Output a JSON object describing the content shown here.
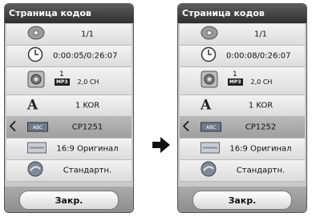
{
  "left": {
    "title": "Страница кодов",
    "title_page": "1/1",
    "time": "0:00:05/0:26:07",
    "audio": {
      "number": "1",
      "format": "MP3",
      "channels": "2,0 CH"
    },
    "subtitle_lang": "1 KOR",
    "code_page_icon": "ABC",
    "code_page": "CP1251",
    "aspect": "16:9 Оригинал",
    "picture_mode": "Стандартн.",
    "close_label": "Закр."
  },
  "right": {
    "title": "Страница кодов",
    "title_page": "1/1",
    "time": "0:00:08/0:26:07",
    "audio": {
      "number": "1",
      "format": "MP3",
      "channels": "2,0 CH"
    },
    "subtitle_lang": "1 KOR",
    "code_page_icon": "ABC",
    "code_page": "CP1252",
    "aspect": "16:9 Оригинал",
    "picture_mode": "Стандартн.",
    "close_label": "Закр."
  },
  "icons": {
    "title": "disc-icon",
    "time": "clock-icon",
    "audio": "speaker-icon",
    "subtitle": "font-a-icon",
    "code_page": "abc-chip-icon",
    "aspect": "aspect-ratio-icon",
    "picture": "picture-mode-icon",
    "transition": "right-arrow-icon"
  },
  "colors": {
    "title_bar": "#3a3a3a",
    "selected_row": "#a9a9a9",
    "row": "#e8e8e8"
  }
}
